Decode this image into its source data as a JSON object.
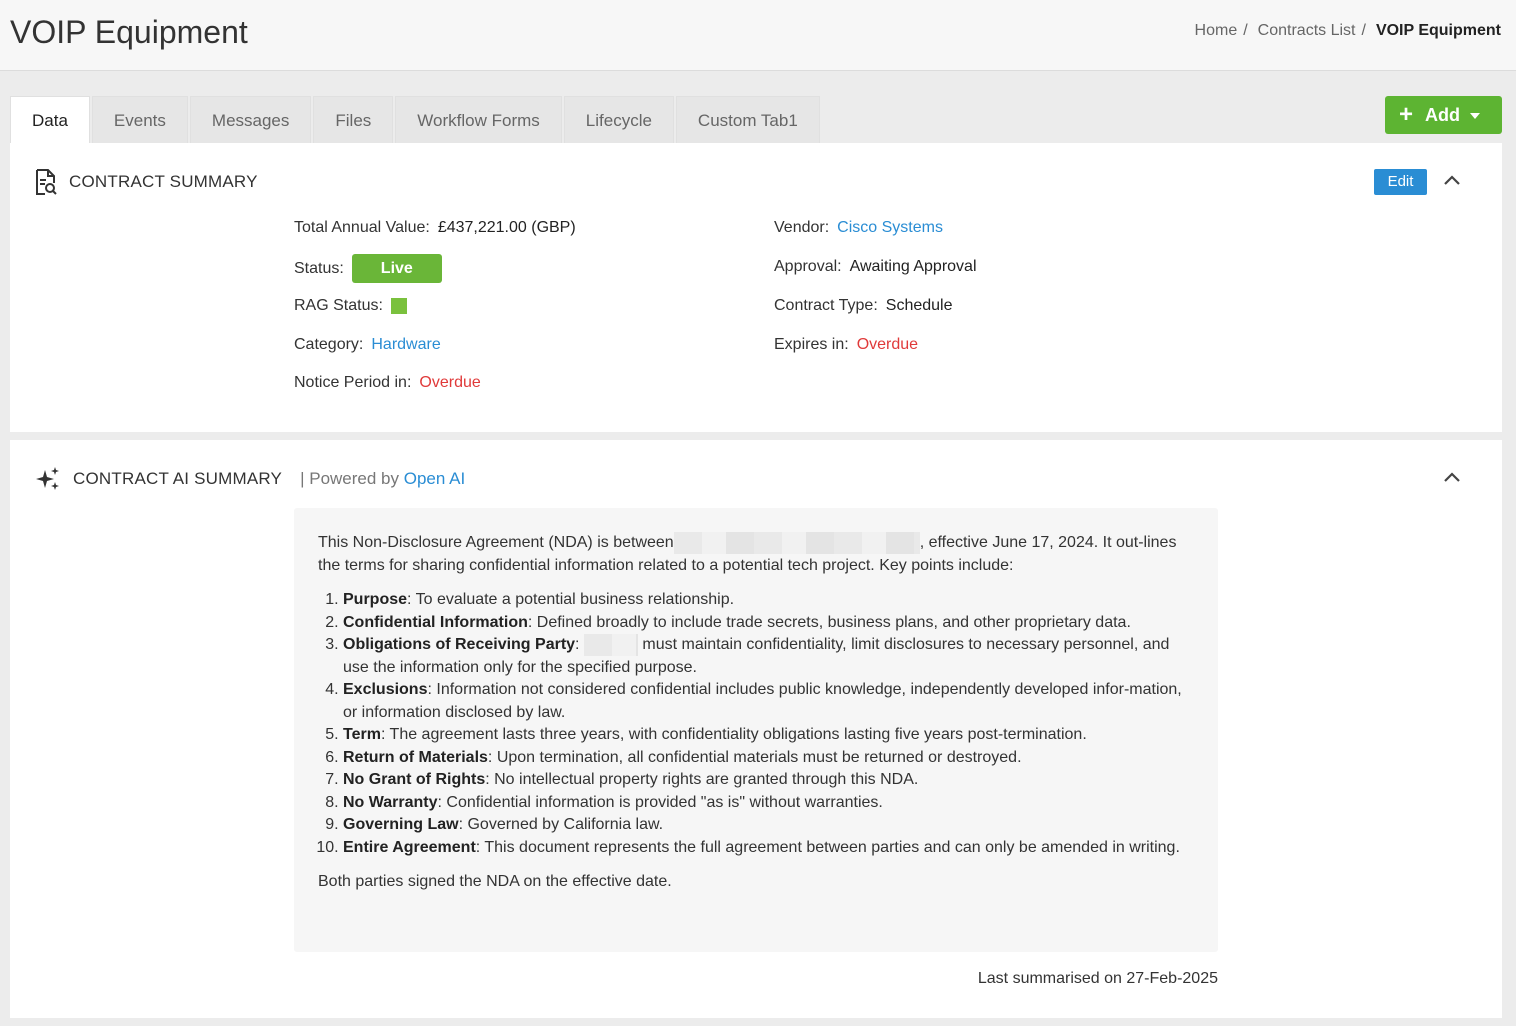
{
  "header": {
    "title": "VOIP Equipment",
    "breadcrumb": [
      {
        "label": "Home"
      },
      {
        "label": "Contracts List"
      },
      {
        "label": "VOIP Equipment"
      }
    ]
  },
  "tabs": [
    {
      "label": "Data",
      "active": true
    },
    {
      "label": "Events"
    },
    {
      "label": "Messages"
    },
    {
      "label": "Files"
    },
    {
      "label": "Workflow Forms"
    },
    {
      "label": "Lifecycle"
    },
    {
      "label": "Custom Tab1"
    }
  ],
  "add_button": {
    "label": "Add"
  },
  "summary": {
    "title": "CONTRACT SUMMARY",
    "edit_label": "Edit",
    "total_annual_value_label": "Total Annual Value:",
    "total_annual_value": "£437,221.00 (GBP)",
    "status_label": "Status:",
    "status": "Live",
    "rag_label": "RAG Status:",
    "rag_color": "#7ac13d",
    "category_label": "Category:",
    "category": "Hardware",
    "notice_label": "Notice Period in:",
    "notice": "Overdue",
    "vendor_label": "Vendor:",
    "vendor": "Cisco Systems",
    "approval_label": "Approval:",
    "approval": "Awaiting Approval",
    "contract_type_label": "Contract Type:",
    "contract_type": "Schedule",
    "expires_label": "Expires in:",
    "expires": "Overdue"
  },
  "ai_summary": {
    "title": "CONTRACT AI SUMMARY",
    "powered_prefix": "| Powered by",
    "powered_link": "Open AI",
    "intro_a": "This Non-Disclosure Agreement (NDA) is between",
    "intro_b": ", effective June 17, 2024. It out-lines the terms for sharing confidential information related to a potential tech project. Key points include:",
    "points": [
      {
        "term": "Purpose",
        "text": ": To evaluate a potential business relationship."
      },
      {
        "term": "Confidential Information",
        "text": ": Defined broadly to include trade secrets, business plans, and other proprietary data."
      },
      {
        "term": "Obligations of Receiving Party",
        "text": " must maintain confidentiality, limit disclosures to necessary personnel, and use the information only for the specified purpose."
      },
      {
        "term": "Exclusions",
        "text": ": Information not considered confidential includes public knowledge, independently developed infor-mation, or information disclosed by law."
      },
      {
        "term": "Term",
        "text": ": The agreement lasts three years, with confidentiality obligations lasting five years post-termination."
      },
      {
        "term": "Return of Materials",
        "text": ": Upon termination, all confidential materials must be returned or destroyed."
      },
      {
        "term": "No Grant of Rights",
        "text": ": No intellectual property rights are granted through this NDA."
      },
      {
        "term": "No Warranty",
        "text": ": Confidential information is provided \"as is\" without warranties."
      },
      {
        "term": "Governing Law",
        "text": ": Governed by California law."
      },
      {
        "term": "Entire Agreement",
        "text": ": This document represents the full agreement between parties and can only be amended in writing."
      }
    ],
    "closing": "Both parties signed the NDA on the effective date.",
    "last_summarised": "Last summarised on 27-Feb-2025"
  },
  "colors": {
    "link": "#2a8dd4",
    "overdue": "#e03a3a",
    "live": "#6ab638",
    "add": "#5db432"
  }
}
